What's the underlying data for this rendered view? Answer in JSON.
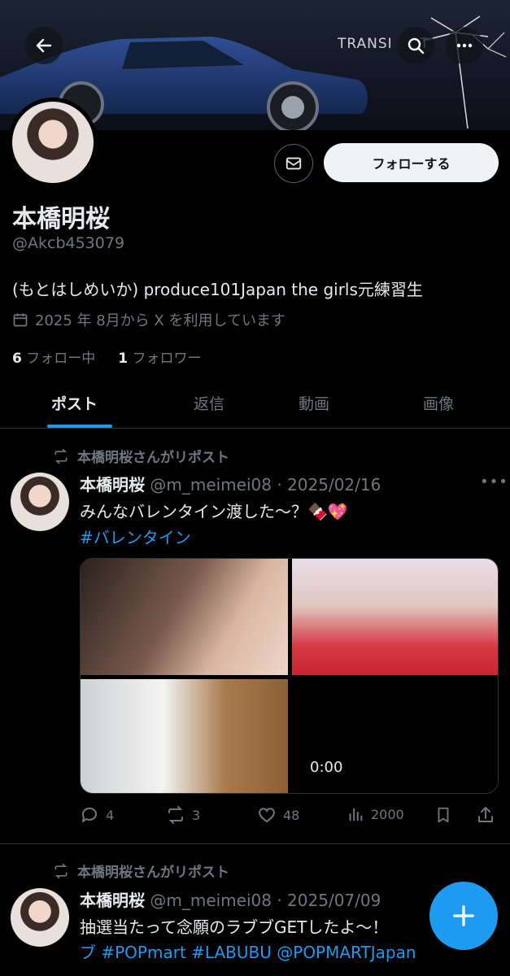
{
  "header": {
    "banner_text": "TRANSI",
    "banner_text2": "T"
  },
  "profile": {
    "name": "本橋明桜",
    "handle": "@Akcb453079",
    "bio": "(もとはしめいか) produce101Japan the girls元練習生",
    "joined": "2025 年 8月から X を利用しています",
    "following_count": "6",
    "following_label": "フォロー中",
    "followers_count": "1",
    "followers_label": "フォロワー",
    "follow_button": "フォローする"
  },
  "tabs": [
    {
      "label": "ポスト",
      "active": true
    },
    {
      "label": "返信",
      "active": false
    },
    {
      "label": "動画",
      "active": false
    },
    {
      "label": "画像",
      "active": false
    }
  ],
  "tweets": [
    {
      "repost_label": "本橋明桜さんがリポスト",
      "author": "本橋明桜",
      "meta": "@m_meimei08 · 2025/02/16",
      "text": "みんなバレンタイン渡した〜？🍫💖",
      "hashtags": "#バレンタイン",
      "video_time": "0:00",
      "replies": "4",
      "reposts": "3",
      "likes": "48",
      "views": "2000"
    },
    {
      "repost_label": "本橋明桜さんがリポスト",
      "author": "本橋明桜",
      "meta": "@m_meimei08 · 2025/07/09",
      "text": "抽選当たって念願のラブブGETしたよ〜！",
      "hashtags": "ブ  #POPmart  #LABUBU @POPMARTJapan"
    }
  ],
  "colors": {
    "accent": "#1d9bf0",
    "muted": "#71767b",
    "text": "#e7e9ea",
    "divider": "#2f3336",
    "background": "#000000"
  },
  "icons": [
    "back-arrow-icon",
    "search-icon",
    "more-icon",
    "mail-icon",
    "calendar-icon",
    "repost-icon",
    "reply-icon",
    "like-icon",
    "views-icon",
    "bookmark-icon",
    "share-icon",
    "plus-icon"
  ]
}
